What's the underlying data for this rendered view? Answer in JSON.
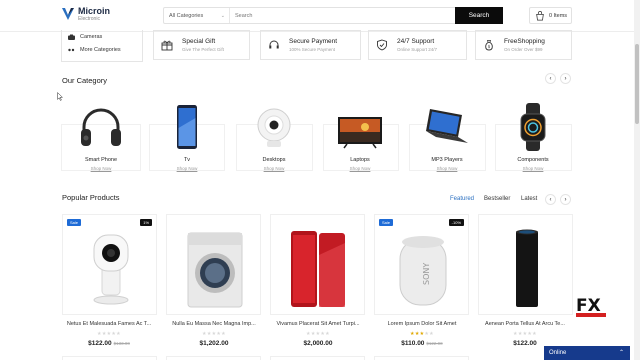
{
  "brand": {
    "name": "Microin",
    "tagline": "Electronic",
    "accent_color": "#2a6fc0"
  },
  "search": {
    "category_label": "All Categories",
    "placeholder": "Search",
    "button_label": "Search"
  },
  "cart": {
    "label": "0 Items",
    "icon": "cart-icon"
  },
  "side_menu": {
    "items": [
      {
        "label": "Cameras",
        "icon": "camera-icon"
      },
      {
        "label": "More Categories",
        "icon": "list-icon"
      }
    ]
  },
  "features": [
    {
      "title": "Special Gift",
      "subtitle": "Give The Perfect Gift",
      "icon": "gift-icon"
    },
    {
      "title": "Secure Payment",
      "subtitle": "100% Secure Payment",
      "icon": "headset-icon"
    },
    {
      "title": "24/7 Support",
      "subtitle": "Online Support 24/7",
      "icon": "shield-icon"
    },
    {
      "title": "FreeShopping",
      "subtitle": "On Order Over $99",
      "icon": "money-bag-icon"
    }
  ],
  "category_section": {
    "title": "Our Category",
    "prev": "‹",
    "next": "›",
    "items": [
      {
        "name": "Smart Phone",
        "link": "Shop Now",
        "icon": "headphones-image"
      },
      {
        "name": "Tv",
        "link": "Shop Now",
        "icon": "smartphone-image"
      },
      {
        "name": "Desktops",
        "link": "Shop Now",
        "icon": "webcam-image"
      },
      {
        "name": "Laptops",
        "link": "Shop Now",
        "icon": "tv-image"
      },
      {
        "name": "MP3 Players",
        "link": "Shop Now",
        "icon": "laptop-image"
      },
      {
        "name": "Components",
        "link": "Shop Now",
        "icon": "smartwatch-image"
      }
    ]
  },
  "products_section": {
    "title": "Popular Products",
    "tabs": [
      "Featured",
      "Bestseller",
      "Latest"
    ],
    "prev": "‹",
    "next": "›",
    "items": [
      {
        "name": "Netus Et Malesuada Fames Ac T...",
        "price": "$122.00",
        "old_price": "$133.00",
        "badge": "Sale",
        "badge_right": "1%",
        "rating": 0,
        "image": "camera-product"
      },
      {
        "name": "Nulla Eu Massa Nec Magna Imp...",
        "price": "$1,202.00",
        "old_price": "",
        "badge": "",
        "badge_right": "",
        "rating": 0,
        "image": "washer-product"
      },
      {
        "name": "Vivamus Placerat Sit Amet Turpi...",
        "price": "$2,000.00",
        "old_price": "",
        "badge": "",
        "badge_right": "",
        "rating": 0,
        "image": "phone-product"
      },
      {
        "name": "Lorem Ipsum Dolor Sit Amet",
        "price": "$110.00",
        "old_price": "$122.00",
        "badge": "Sale",
        "badge_right": "-10%",
        "rating": 3,
        "image": "speaker-product"
      },
      {
        "name": "Aenean Porta Tellus At Arcu Te...",
        "price": "$122.00",
        "old_price": "",
        "badge": "",
        "badge_right": "",
        "rating": 0,
        "image": "echo-product"
      }
    ]
  },
  "chat": {
    "label": "Online"
  },
  "watermark": {
    "text": "FX"
  }
}
